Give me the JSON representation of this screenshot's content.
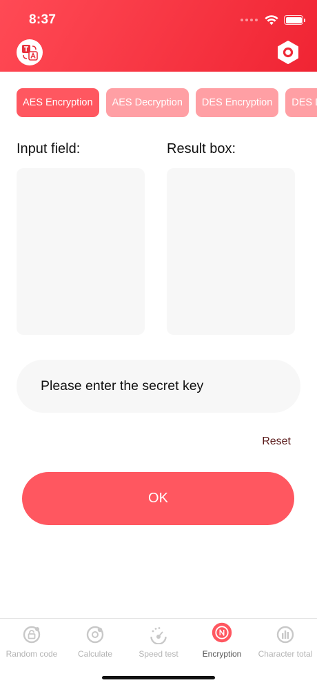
{
  "status_bar": {
    "time": "8:37"
  },
  "colors": {
    "accent": "#ff5760",
    "accent_light": "#ff9fa4",
    "header_start": "#ff4a55",
    "header_end": "#f02433",
    "field_bg": "#f7f7f7"
  },
  "header": {
    "left_icon": "translate-icon",
    "right_icon": "settings-hexagon-icon"
  },
  "tabs": [
    {
      "label": "AES Encryption",
      "active": true
    },
    {
      "label": "AES Decryption",
      "active": false
    },
    {
      "label": "DES Encryption",
      "active": false
    },
    {
      "label": "DES Decryption",
      "active": false
    }
  ],
  "form": {
    "input_label": "Input field:",
    "result_label": "Result box:",
    "input_value": "",
    "result_value": "",
    "key_placeholder": "Please enter the secret key",
    "reset_label": "Reset",
    "ok_label": "OK"
  },
  "bottom_nav": [
    {
      "label": "Random code",
      "icon": "random-code-icon",
      "active": false
    },
    {
      "label": "Calculate",
      "icon": "calculate-icon",
      "active": false
    },
    {
      "label": "Speed test",
      "icon": "speed-test-icon",
      "active": false
    },
    {
      "label": "Encryption",
      "icon": "encryption-icon",
      "active": true
    },
    {
      "label": "Character total",
      "icon": "character-total-icon",
      "active": false
    }
  ]
}
